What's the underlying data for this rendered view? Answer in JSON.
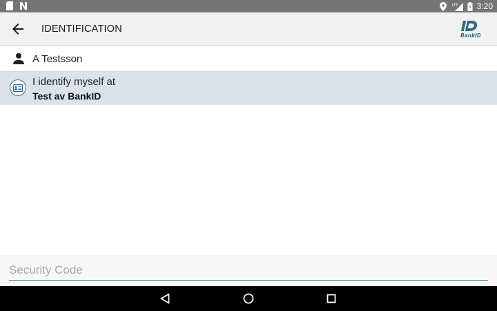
{
  "status_bar": {
    "time": "3:20",
    "left_icons": [
      "sd-card-icon",
      "n-notification-icon"
    ],
    "right_icons": [
      "location-icon",
      "lte-signal-icon",
      "battery-icon"
    ],
    "network_label": "LTE"
  },
  "toolbar": {
    "title": "IDENTIFICATION",
    "back_icon": "arrow-back-icon",
    "logo_text": "BankID"
  },
  "user": {
    "name": "A Testsson",
    "icon": "person-icon"
  },
  "identification": {
    "line1": "I identify myself at",
    "line2": "Test av BankID",
    "icon": "id-card-icon"
  },
  "security_code": {
    "placeholder": "Security Code",
    "value": ""
  },
  "nav_bar": {
    "buttons": [
      "back-triangle-icon",
      "home-circle-icon",
      "recents-square-icon"
    ]
  },
  "colors": {
    "status_bar": "#757575",
    "toolbar": "#f1f1f1",
    "selected_row": "#dbe2e8",
    "accent": "#2f6b84",
    "input_underline": "#4c8079"
  }
}
